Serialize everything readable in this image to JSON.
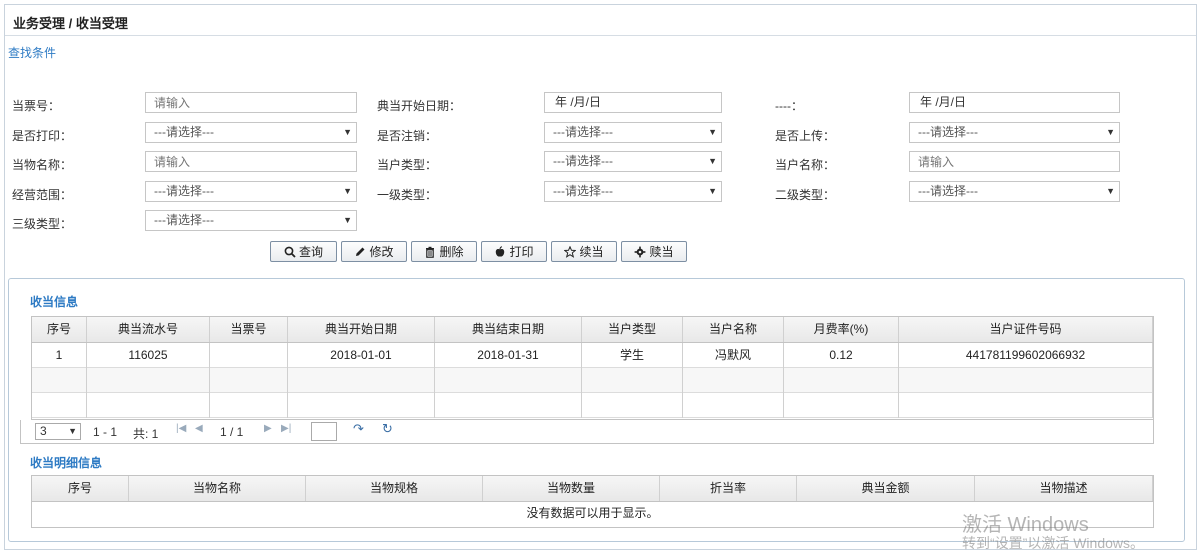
{
  "header": {
    "breadcrumb": "业务受理 / 收当受理"
  },
  "search": {
    "title": "查找条件",
    "rows": [
      [
        {
          "label": "当票号：",
          "type": "input",
          "placeholder": "请输入"
        },
        {
          "label": "典当开始日期：",
          "type": "date",
          "value": "年 /月/日"
        },
        {
          "label": "----：",
          "type": "date",
          "value": "年 /月/日"
        }
      ],
      [
        {
          "label": "是否打印：",
          "type": "select",
          "value": "---请选择---"
        },
        {
          "label": "是否注销：",
          "type": "select",
          "value": "---请选择---"
        },
        {
          "label": "是否上传：",
          "type": "select",
          "value": "---请选择---"
        }
      ],
      [
        {
          "label": "当物名称：",
          "type": "input",
          "placeholder": "请输入"
        },
        {
          "label": "当户类型：",
          "type": "select",
          "value": "---请选择---"
        },
        {
          "label": "当户名称：",
          "type": "input",
          "placeholder": "请输入"
        }
      ],
      [
        {
          "label": "经营范围：",
          "type": "select",
          "value": "---请选择---"
        },
        {
          "label": "一级类型：",
          "type": "select",
          "value": "---请选择---"
        },
        {
          "label": "二级类型：",
          "type": "select",
          "value": "---请选择---"
        }
      ],
      [
        {
          "label": "三级类型：",
          "type": "select",
          "value": "---请选择---"
        }
      ]
    ]
  },
  "toolbar": {
    "query": "查询",
    "edit": "修改",
    "delete": "删除",
    "print": "打印",
    "renew": "续当",
    "redeem": "赎当"
  },
  "pawn_info": {
    "title": "收当信息",
    "columns": [
      "序号",
      "典当流水号",
      "当票号",
      "典当开始日期",
      "典当结束日期",
      "当户类型",
      "当户名称",
      "月费率(%)",
      "当户证件号码"
    ],
    "rows": [
      [
        "1",
        "116025",
        "",
        "2018-01-01",
        "2018-01-31",
        "学生",
        "冯默风",
        "0.12",
        "441781199602066932"
      ]
    ]
  },
  "pager": {
    "page_size": "3",
    "range": "1 - 1",
    "total": "共: 1",
    "page_of": "1 / 1"
  },
  "detail_info": {
    "title": "收当明细信息",
    "columns": [
      "序号",
      "当物名称",
      "当物规格",
      "当物数量",
      "折当率",
      "典当金额",
      "当物描述"
    ],
    "empty_text": "没有数据可以用于显示。"
  },
  "watermark": {
    "line1": "激活 Windows",
    "line2": "转到“设置”以激活 Windows。"
  }
}
